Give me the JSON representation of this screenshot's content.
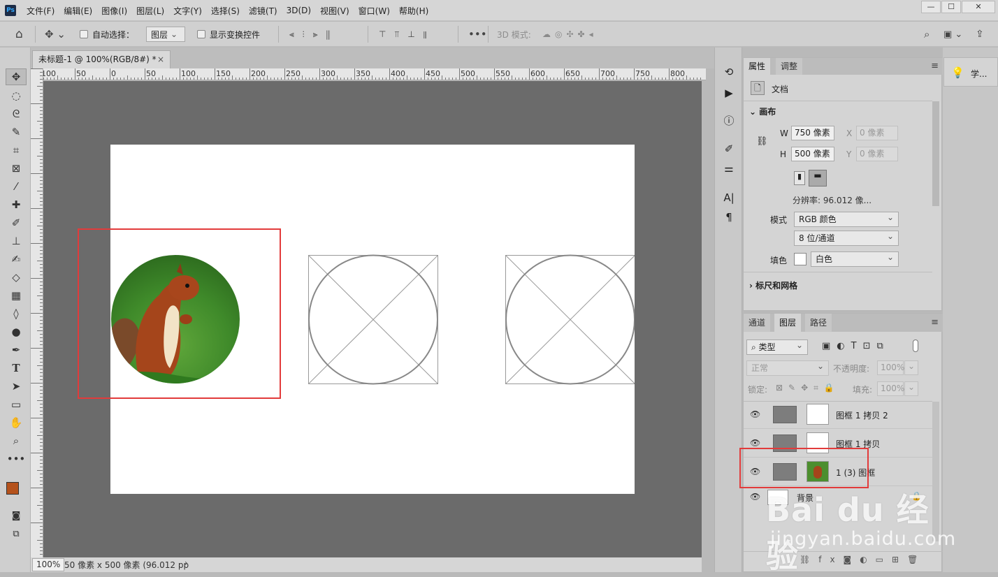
{
  "menubar": {
    "logo": "Ps",
    "items": [
      "文件(F)",
      "编辑(E)",
      "图像(I)",
      "图层(L)",
      "文字(Y)",
      "选择(S)",
      "滤镜(T)",
      "3D(D)",
      "视图(V)",
      "窗口(W)",
      "帮助(H)"
    ]
  },
  "options": {
    "auto_select_label": "自动选择：",
    "auto_select_value": "图层",
    "show_transform_label": "显示变换控件",
    "mode_3d_label": "3D 模式:"
  },
  "document": {
    "tab_title": "未标题-1 @ 100%(RGB/8#) *",
    "zoom": "100%",
    "status": "50 像素 x 500 像素 (96.012 pp"
  },
  "ruler": {
    "top_labels": [
      "100",
      "50",
      "0",
      "50",
      "100",
      "150",
      "200",
      "250",
      "300",
      "350",
      "400",
      "450",
      "500",
      "550",
      "600",
      "650",
      "700",
      "750",
      "800"
    ]
  },
  "properties": {
    "tabs": [
      "属性",
      "调整"
    ],
    "doc_label": "文档",
    "canvas_section": "画布",
    "w_label": "W",
    "w_value": "750 像素",
    "h_label": "H",
    "h_value": "500 像素",
    "x_label": "X",
    "x_value": "0 像素",
    "y_label": "Y",
    "y_value": "0 像素",
    "resolution": "分辨率: 96.012 像...",
    "mode_label": "模式",
    "mode_value": "RGB 颜色",
    "depth_value": "8 位/通道",
    "fill_label": "填色",
    "fill_value": "白色",
    "rulers_section": "标尺和网格"
  },
  "layers_panel": {
    "tabs": [
      "通道",
      "图层",
      "路径"
    ],
    "filter": "类型",
    "blend": "正常",
    "opacity_label": "不透明度:",
    "opacity_value": "100%",
    "lock_label": "锁定:",
    "fill_label": "填充:",
    "fill_value": "100%",
    "layers": [
      {
        "name": "图框 1 拷贝 2"
      },
      {
        "name": "图框 1 拷贝"
      },
      {
        "name": "1 (3) 图框"
      },
      {
        "name": "背景"
      }
    ]
  },
  "learn": {
    "label": "学..."
  },
  "watermark": {
    "brand": "Bai du 经验",
    "url": "jingyan.baidu.com"
  },
  "colors": {
    "foreground": "#b5521c",
    "background": "#ffffff",
    "highlight": "#e23b3b"
  }
}
